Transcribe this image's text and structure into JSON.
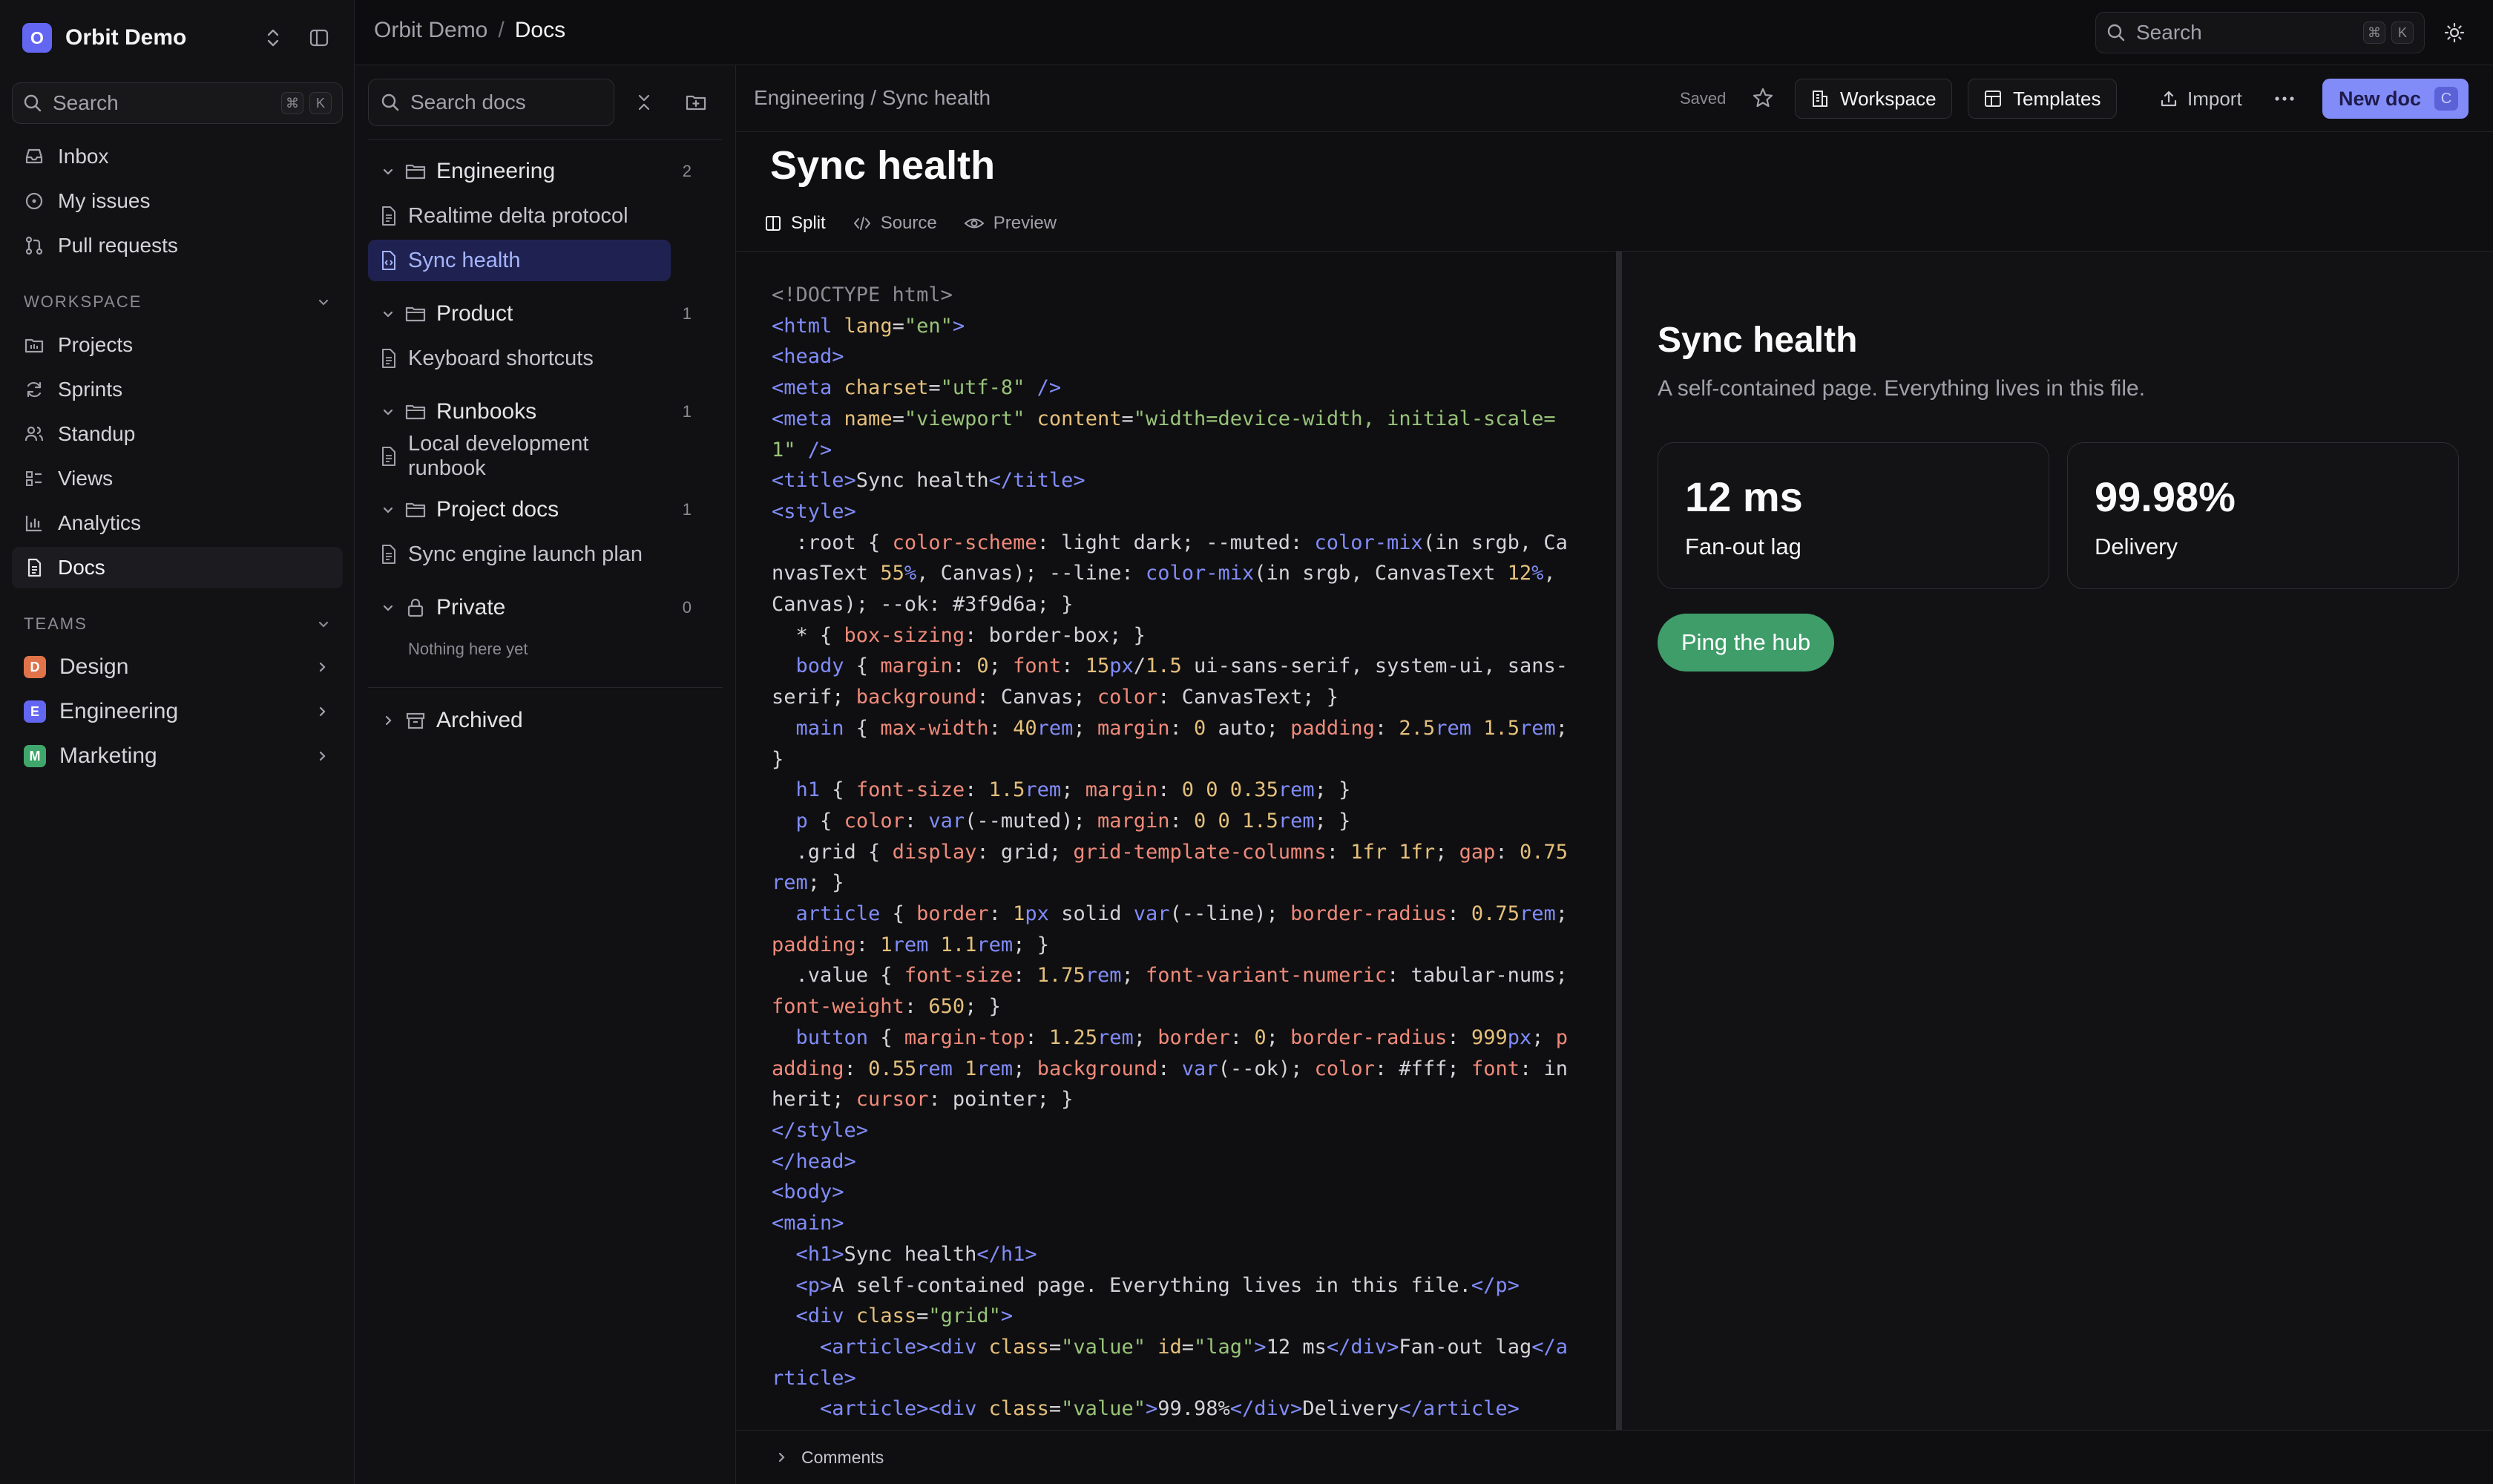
{
  "workspace": {
    "logo_letter": "O",
    "name": "Orbit Demo",
    "accent": "#6366f1"
  },
  "sidebar": {
    "search": {
      "placeholder": "Search",
      "kbd1": "⌘",
      "kbd2": "K"
    },
    "primary": [
      {
        "label": "Inbox",
        "icon": "inbox-icon"
      },
      {
        "label": "My issues",
        "icon": "issues-icon"
      },
      {
        "label": "Pull requests",
        "icon": "pull-request-icon"
      }
    ],
    "workspace_heading": "WORKSPACE",
    "workspace_items": [
      {
        "label": "Projects",
        "icon": "projects-icon"
      },
      {
        "label": "Sprints",
        "icon": "sprints-icon"
      },
      {
        "label": "Standup",
        "icon": "standup-icon"
      },
      {
        "label": "Views",
        "icon": "views-icon"
      },
      {
        "label": "Analytics",
        "icon": "analytics-icon"
      },
      {
        "label": "Docs",
        "icon": "docs-icon",
        "active": true
      }
    ],
    "teams_heading": "TEAMS",
    "teams": [
      {
        "badge": "D",
        "label": "Design",
        "color": "#e0734a"
      },
      {
        "badge": "E",
        "label": "Engineering",
        "color": "#6366f1"
      },
      {
        "badge": "M",
        "label": "Marketing",
        "color": "#3fa76b"
      }
    ]
  },
  "topbar": {
    "crumb_root": "Orbit Demo",
    "crumb_sep": "/",
    "crumb_current": "Docs",
    "search": {
      "placeholder": "Search",
      "kbd1": "⌘",
      "kbd2": "K"
    }
  },
  "tree": {
    "search_placeholder": "Search docs",
    "folders": [
      {
        "label": "Engineering",
        "count": "2",
        "docs": [
          "Realtime delta protocol",
          "Sync health"
        ]
      },
      {
        "label": "Product",
        "count": "1",
        "docs": [
          "Keyboard shortcuts"
        ]
      },
      {
        "label": "Runbooks",
        "count": "1",
        "docs": [
          "Local development runbook"
        ]
      },
      {
        "label": "Project docs",
        "count": "1",
        "docs": [
          "Sync engine launch plan"
        ]
      },
      {
        "label": "Private",
        "count": "0",
        "docs": []
      }
    ],
    "private_empty": "Nothing here yet",
    "archived": "Archived",
    "active_doc": "Sync health"
  },
  "editor": {
    "path": "Engineering / Sync health",
    "saved": "Saved",
    "workspace_btn": "Workspace",
    "templates_btn": "Templates",
    "import_btn": "Import",
    "new_doc_btn": "New doc",
    "new_doc_kbd": "C",
    "title": "Sync health",
    "tabs": {
      "split": "Split",
      "source": "Source",
      "preview": "Preview"
    },
    "active_tab": "Split",
    "comments": "Comments"
  },
  "preview": {
    "title": "Sync health",
    "subtitle": "A self-contained page. Everything lives in this file.",
    "cards": [
      {
        "value": "12 ms",
        "caption": "Fan-out lag"
      },
      {
        "value": "99.98%",
        "caption": "Delivery"
      }
    ],
    "button": "Ping the hub",
    "ok_color": "#3f9d6a"
  }
}
